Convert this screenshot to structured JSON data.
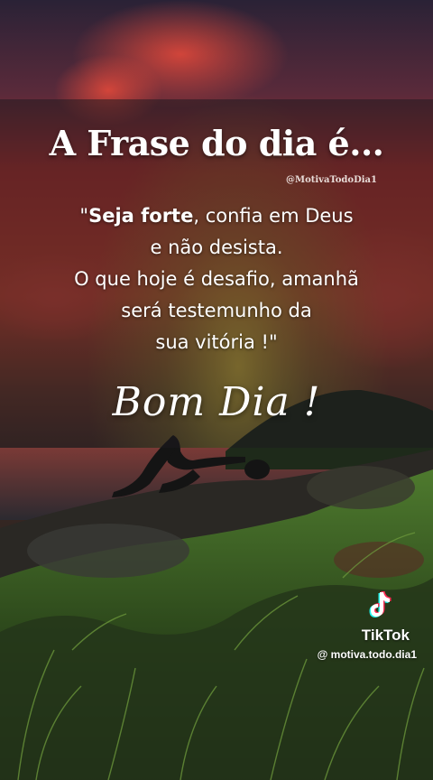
{
  "title": "A Frase do dia é...",
  "handle": "@MotivaTodoDia1",
  "quote": {
    "bold_part": "Seja forte",
    "line1_rest": ", confia em Deus",
    "line1_prefix": "\"",
    "line2": "e não desista.",
    "line3": "O que hoje é desafio, amanhã",
    "line4": "será testemunho da",
    "line5": "sua vitória !\""
  },
  "signoff": "Bom Dia !",
  "watermark": {
    "brand": "TikTok",
    "user": "@ motiva.todo.dia1",
    "icon": "tiktok-logo-icon"
  },
  "colors": {
    "sky_red": "#c42a2a",
    "sky_dark": "#2a2236",
    "grass_green": "#4e7a2e",
    "overlay": "#1c181e"
  }
}
